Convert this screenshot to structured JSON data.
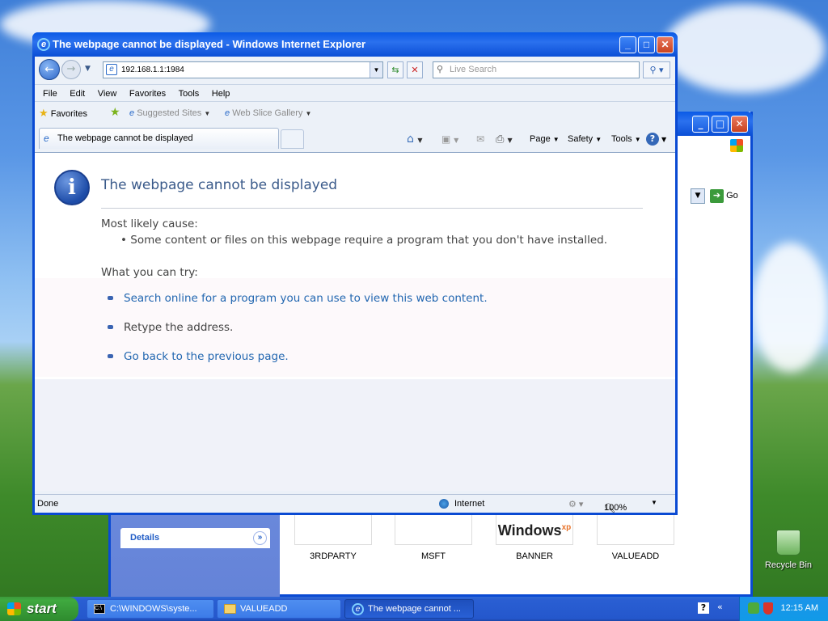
{
  "ie": {
    "title": "The webpage cannot be displayed - Windows Internet Explorer",
    "address": "192.168.1.1:1984",
    "search_placeholder": "Live Search",
    "menu": [
      "File",
      "Edit",
      "View",
      "Favorites",
      "Tools",
      "Help"
    ],
    "favorites_label": "Favorites",
    "suggested_sites": "Suggested Sites",
    "web_slice_gallery": "Web Slice Gallery",
    "tab_title": "The webpage cannot be displayed",
    "commands": {
      "page": "Page",
      "safety": "Safety",
      "tools": "Tools"
    },
    "status": {
      "left": "Done",
      "zone": "Internet",
      "zoom": "100%"
    }
  },
  "error_page": {
    "title": "The webpage cannot be displayed",
    "cause_heading": "Most likely cause:",
    "cause_item": "Some content or files on this webpage require a program that you don't have installed.",
    "try_heading": "What you can try:",
    "options": [
      "Search online for a program you can use to view this web content.",
      "Retype the address.",
      "Go back to the previous page."
    ]
  },
  "explorer": {
    "go_label": "Go",
    "details_label": "Details",
    "files": [
      "3RDPARTY",
      "MSFT",
      "BANNER",
      "VALUEADD"
    ],
    "banner_logo": "Windows"
  },
  "desktop": {
    "recycle_bin": "Recycle Bin"
  },
  "taskbar": {
    "start": "start",
    "tasks": [
      "C:\\WINDOWS\\syste...",
      "VALUEADD",
      "The webpage cannot ..."
    ],
    "clock": "12:15 AM"
  }
}
